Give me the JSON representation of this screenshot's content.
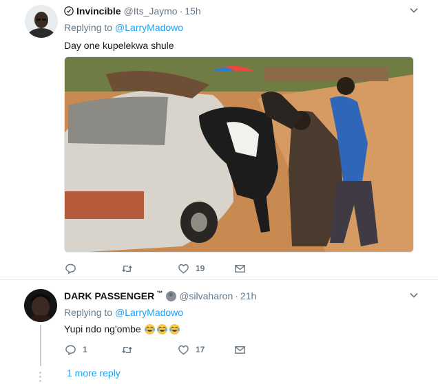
{
  "tweets": [
    {
      "name": "Invincible",
      "handle": "@Its_Jaymo",
      "separator": "·",
      "time": "15h",
      "replying_prefix": "Replying to",
      "replying_to": "@LarryMadowo",
      "text": "Day one kupelekwa shule",
      "reply_count": "",
      "retweet_count": "",
      "like_count": "19"
    },
    {
      "name": "DARK PASSENGER",
      "name_suffix": "™",
      "handle": "@silvaharon",
      "separator": "·",
      "time": "21h",
      "replying_prefix": "Replying to",
      "replying_to": "@LarryMadowo",
      "text": "Yupi ndo ng'ombe",
      "reply_count": "1",
      "retweet_count": "",
      "like_count": "17",
      "more_replies": "1 more reply"
    }
  ],
  "colors": {
    "link": "#1da1f2",
    "muted": "#657786",
    "text": "#14171a",
    "divider": "#e6ecf0"
  },
  "icons": [
    "verified-badge-icon",
    "moon-icon",
    "chevron-down-icon",
    "reply-icon",
    "retweet-icon",
    "like-icon",
    "direct-message-icon",
    "tears-of-joy-emoji"
  ]
}
